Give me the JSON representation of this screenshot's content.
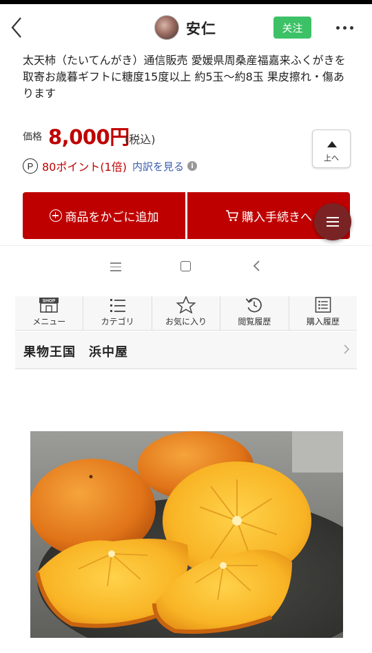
{
  "header": {
    "user_name": "安仁",
    "follow_label": "关注"
  },
  "product": {
    "title": "太天柿（たいてんがき）通信販売 愛媛県周桑産福嘉来ふくがきを取寄お歳暮ギフトに糖度15度以上 約5玉〜約8玉 果皮擦れ・傷あります",
    "price_label": "価格",
    "price": "8,000円",
    "tax_label": "(税込)",
    "points_icon": "P",
    "points": "80ポイント(1倍)",
    "breakdown_link": "内訳を見る"
  },
  "buttons": {
    "up_label": "上へ",
    "add_to_cart": "商品をかごに追加",
    "checkout": "購入手続きへ"
  },
  "shop_nav": [
    {
      "label": "メニュー",
      "icon": "shop-icon"
    },
    {
      "label": "カテゴリ",
      "icon": "list-icon"
    },
    {
      "label": "お気に入り",
      "icon": "star-icon"
    },
    {
      "label": "閲覧履歴",
      "icon": "history-icon"
    },
    {
      "label": "購入履歴",
      "icon": "receipt-icon"
    }
  ],
  "shop": {
    "name": "果物王国　浜中屋"
  },
  "colors": {
    "accent_red": "#bf0000",
    "follow_green": "#3cc166",
    "fab": "#7a2325",
    "link_blue": "#3a5dae"
  }
}
